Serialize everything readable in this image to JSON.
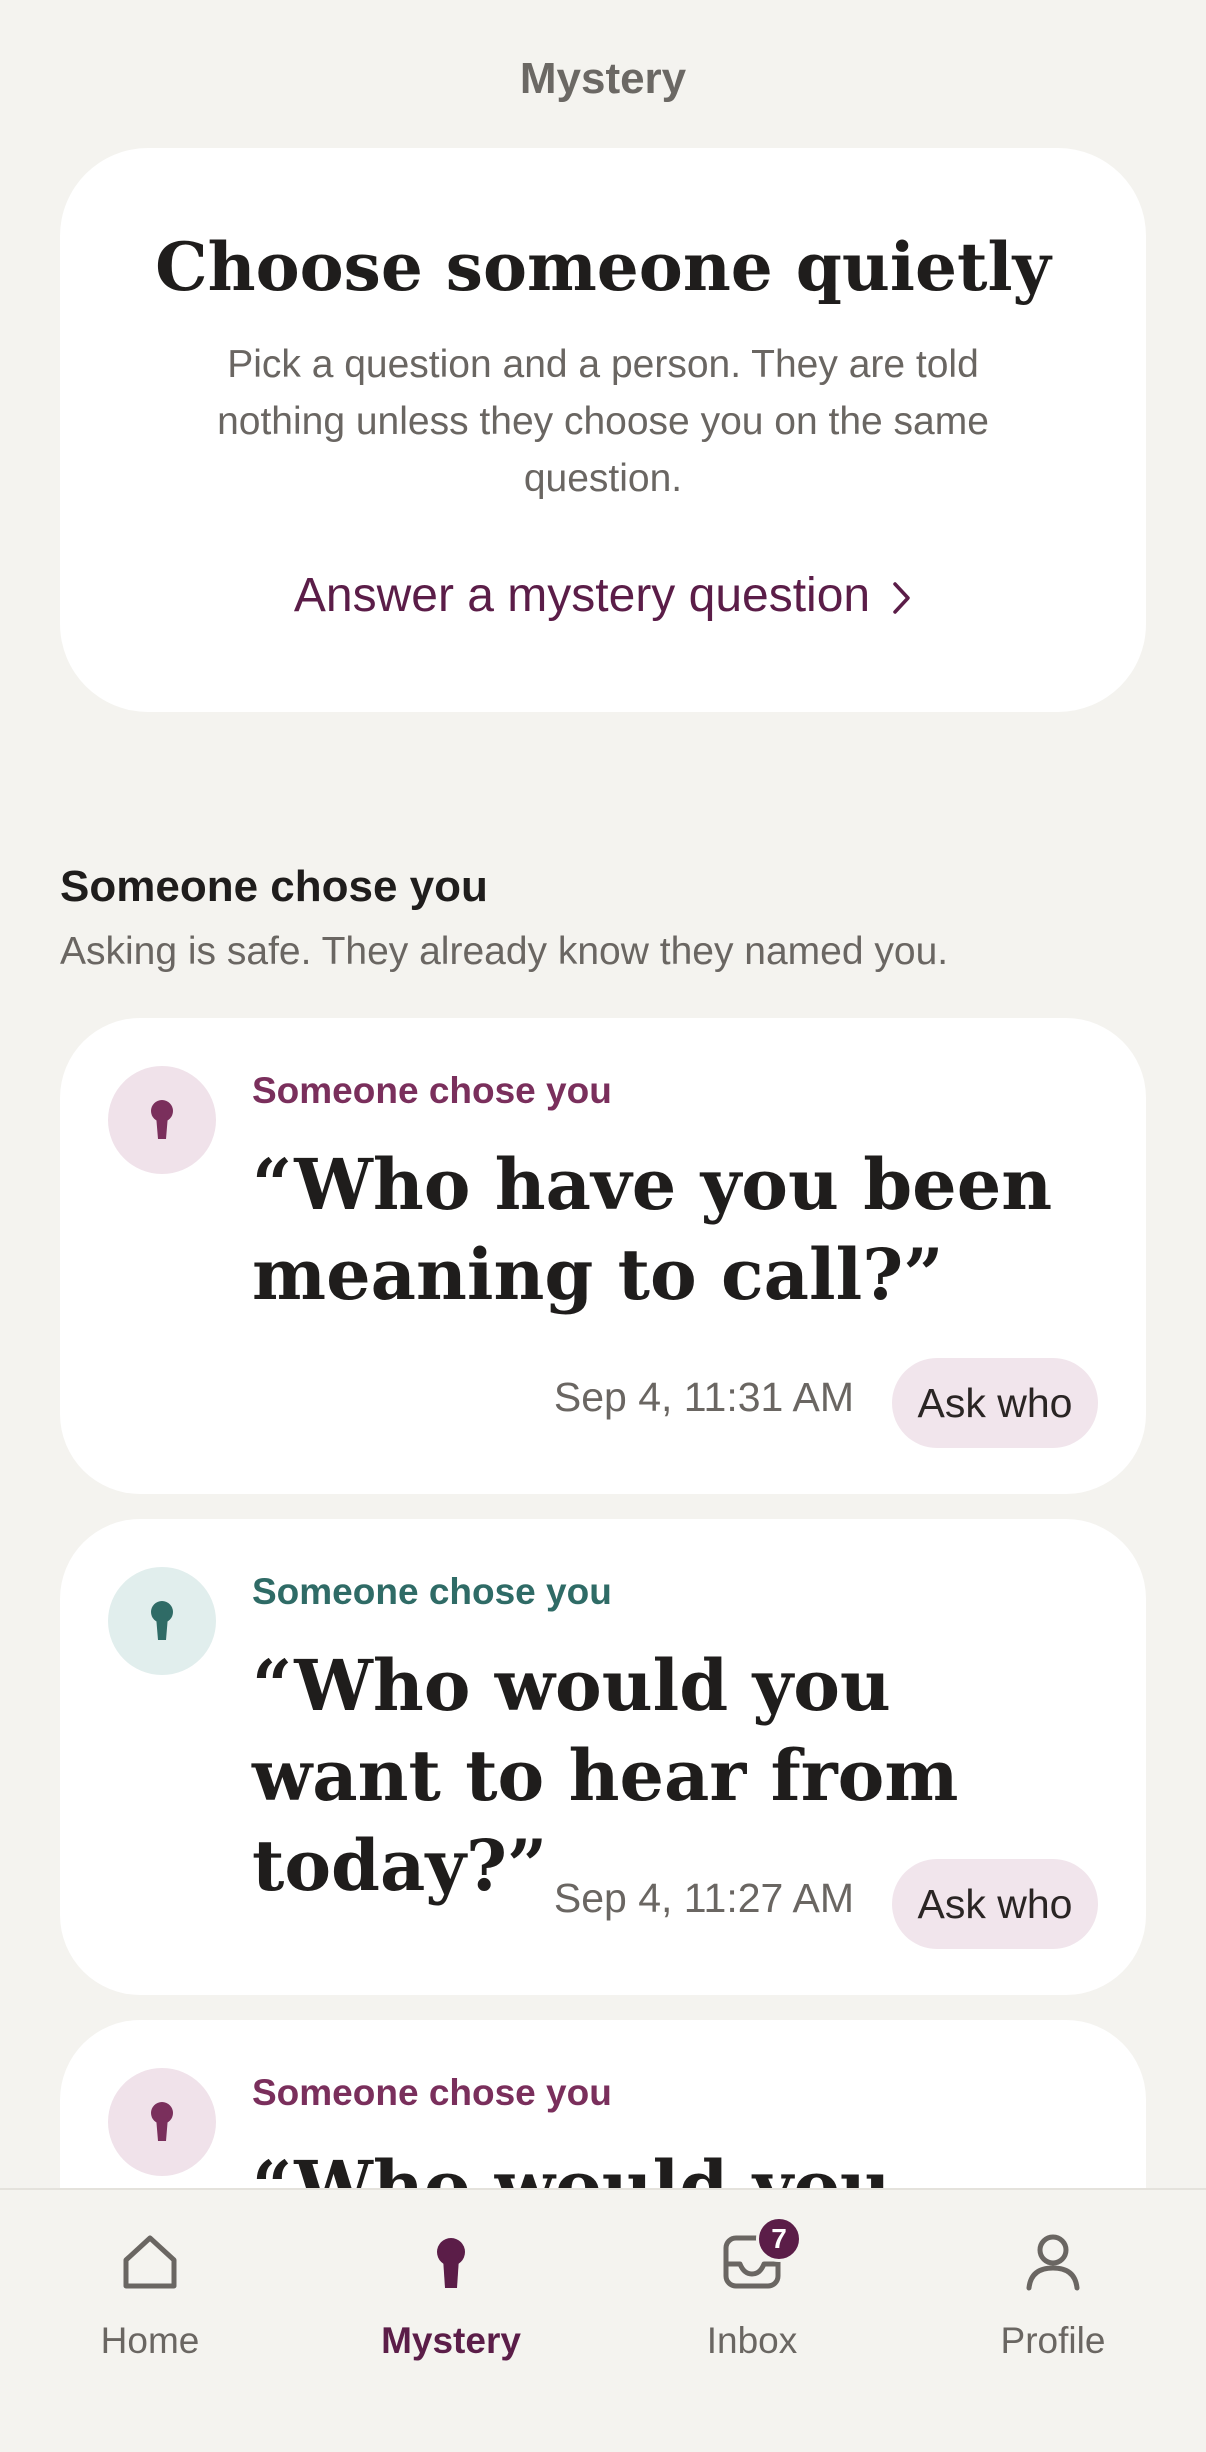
{
  "header": {
    "title": "Mystery"
  },
  "hero": {
    "title": "Choose someone quietly",
    "description": "Pick a question and a person. They are told nothing unless they choose you on the same question.",
    "link_label": "Answer a mystery question"
  },
  "section": {
    "title": "Someone chose you",
    "subtitle": "Asking is safe. They already know they named you."
  },
  "cards": [
    {
      "eyebrow": "Someone chose you",
      "question": "“Who have you been meaning to call?”",
      "time": "Sep 4, 11:31 AM",
      "ask_label": "Ask who",
      "accent": "#7a2f5c",
      "badge_bg": "#f0e2ea",
      "icon": "keyhole-icon"
    },
    {
      "eyebrow": "Someone chose you",
      "question": "“Who would you want to hear from today?”",
      "time": "Sep 4, 11:27 AM",
      "ask_label": "Ask who",
      "accent": "#2f6b66",
      "badge_bg": "#e1eeed",
      "icon": "keyhole-icon"
    },
    {
      "eyebrow": "Someone chose you",
      "question": "“Who would you want to",
      "accent": "#7a2f5c",
      "badge_bg": "#f0e2ea",
      "icon": "keyhole-icon"
    }
  ],
  "tabbar": {
    "home_label": "Home",
    "mystery_label": "Mystery",
    "inbox_label": "Inbox",
    "inbox_count": "7",
    "profile_label": "Profile"
  },
  "colors": {
    "background": "#f4f3ef",
    "brand": "#5b1d48",
    "card": "#ffffff"
  }
}
